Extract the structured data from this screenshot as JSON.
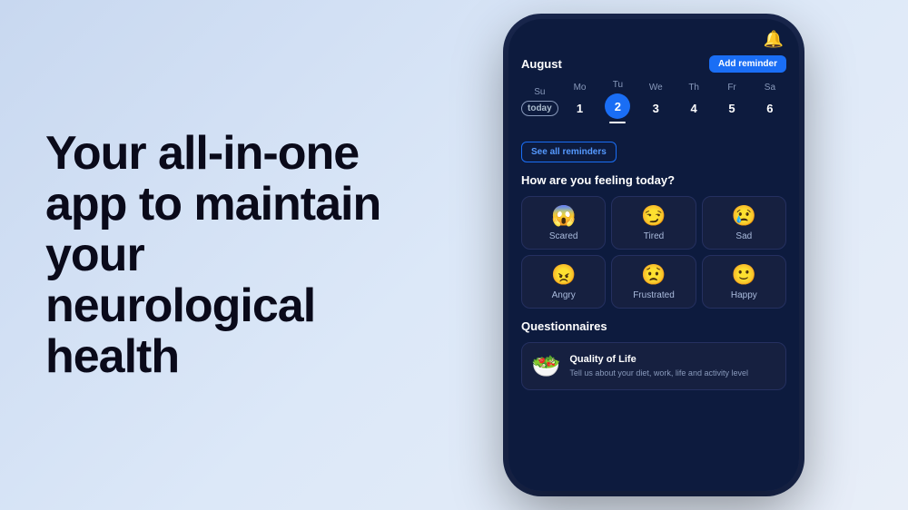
{
  "left": {
    "headline": "Your all-in-one app to maintain your neurological health"
  },
  "phone": {
    "bell_icon": "🔔",
    "calendar": {
      "month": "August",
      "add_reminder_label": "Add reminder",
      "days": [
        {
          "name": "Su",
          "num": "today",
          "is_today": true,
          "is_selected": false
        },
        {
          "name": "Mo",
          "num": "1",
          "is_today": false,
          "is_selected": false
        },
        {
          "name": "Tu",
          "num": "2",
          "is_today": false,
          "is_selected": true
        },
        {
          "name": "We",
          "num": "3",
          "is_today": false,
          "is_selected": false
        },
        {
          "name": "Th",
          "num": "4",
          "is_today": false,
          "is_selected": false
        },
        {
          "name": "Fr",
          "num": "5",
          "is_today": false,
          "is_selected": false
        },
        {
          "name": "Sa",
          "num": "6",
          "is_today": false,
          "is_selected": false
        }
      ]
    },
    "see_all_label": "See all reminders",
    "feeling_title": "How are you feeling today?",
    "emotions": [
      {
        "emoji": "😱",
        "label": "Scared"
      },
      {
        "emoji": "😏",
        "label": "Tired"
      },
      {
        "emoji": "😢",
        "label": "Sad"
      },
      {
        "emoji": "😠",
        "label": "Angry"
      },
      {
        "emoji": "😟",
        "label": "Frustrated"
      },
      {
        "emoji": "🙂",
        "label": "Happy"
      }
    ],
    "questionnaires_title": "Questionnaires",
    "questionnaire_card": {
      "icon": "🥗",
      "title": "Quality of Life",
      "description": "Tell us about your diet, work, life and activity level"
    }
  }
}
